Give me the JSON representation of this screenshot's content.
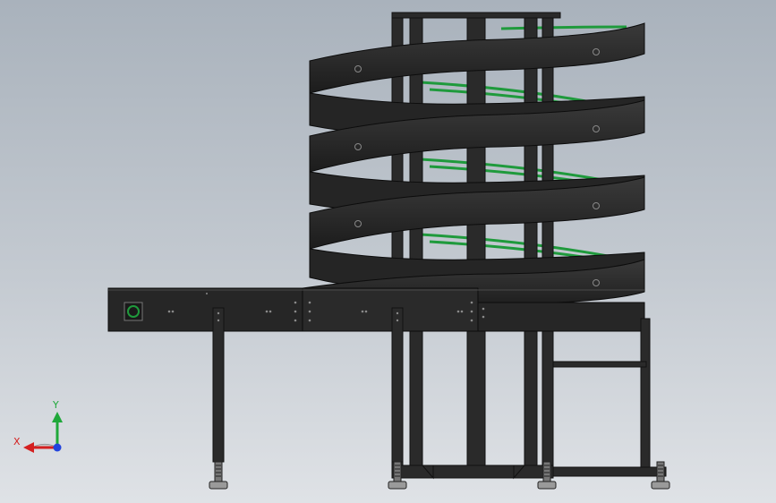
{
  "viewport": {
    "colors": {
      "frame": "#2a2a2a",
      "frame_dark": "#151515",
      "band": "#262626",
      "band_inner": "#3a3a3a",
      "rollers": "#1f9a3c",
      "axis_x": "#d42020",
      "axis_y": "#1fa83a",
      "axis_z": "#2244dd"
    }
  },
  "triad": {
    "x_label": "X",
    "y_label": "Y",
    "icon": "coordinate-triad-icon"
  }
}
